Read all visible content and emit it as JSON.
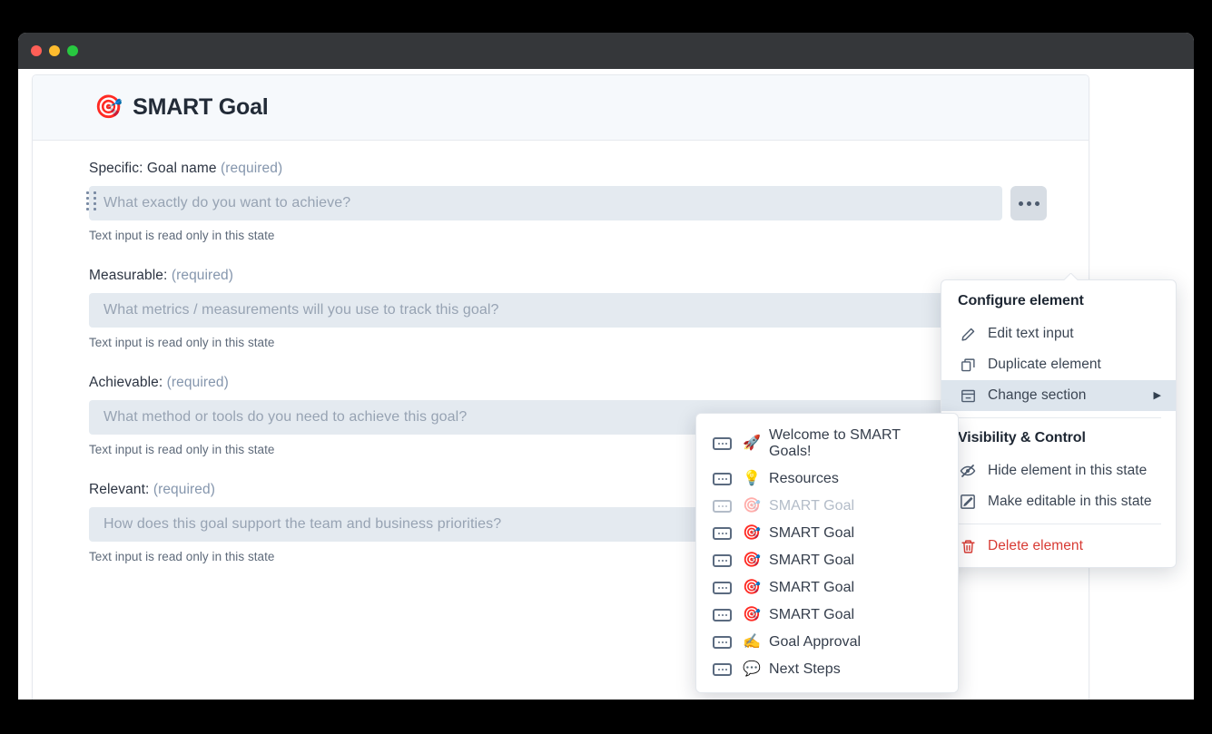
{
  "window": {
    "traffic_lights": [
      "close",
      "minimize",
      "maximize"
    ]
  },
  "card": {
    "emoji": "🎯",
    "title": "SMART Goal"
  },
  "fields": [
    {
      "label": "Specific: Goal name",
      "required": "(required)",
      "placeholder": "What exactly do you want to achieve?",
      "help": "Text input is read only in this state",
      "has_handle": true,
      "has_menu": true
    },
    {
      "label": "Measurable:",
      "required": "(required)",
      "placeholder": "What metrics / measurements will you use to track this goal?",
      "help": "Text input is read only in this state",
      "has_handle": false,
      "has_menu": false
    },
    {
      "label": "Achievable:",
      "required": "(required)",
      "placeholder": "What method or tools do you need to achieve this goal?",
      "help": "Text input is read only in this state",
      "has_handle": false,
      "has_menu": false
    },
    {
      "label": "Relevant:",
      "required": "(required)",
      "placeholder": "How does this goal support the team and business priorities?",
      "help": "Text input is read only in this state",
      "has_handle": false,
      "has_menu": false
    }
  ],
  "context_menu": {
    "group1_title": "Configure element",
    "items1": [
      {
        "label": "Edit text input",
        "icon": "pencil-icon"
      },
      {
        "label": "Duplicate element",
        "icon": "duplicate-icon"
      },
      {
        "label": "Change section",
        "icon": "section-icon",
        "active": true,
        "submenu_arrow": "▶"
      }
    ],
    "group2_title": "Visibility & Control",
    "items2": [
      {
        "label": "Hide element in this state",
        "icon": "eye-slash-icon"
      },
      {
        "label": "Make editable in this state",
        "icon": "edit-square-icon"
      }
    ],
    "delete_label": "Delete element",
    "delete_color": "#d83b34"
  },
  "submenu": {
    "items": [
      {
        "emoji": "🚀",
        "label": "Welcome to SMART Goals!",
        "dimmed": false
      },
      {
        "emoji": "💡",
        "label": "Resources",
        "dimmed": false
      },
      {
        "emoji": "🎯",
        "label": "SMART Goal",
        "dimmed": true
      },
      {
        "emoji": "🎯",
        "label": "SMART Goal",
        "dimmed": false
      },
      {
        "emoji": "🎯",
        "label": "SMART Goal",
        "dimmed": false
      },
      {
        "emoji": "🎯",
        "label": "SMART Goal",
        "dimmed": false
      },
      {
        "emoji": "🎯",
        "label": "SMART Goal",
        "dimmed": false
      },
      {
        "emoji": "✍️",
        "label": "Goal Approval",
        "dimmed": false
      },
      {
        "emoji": "💬",
        "label": "Next Steps",
        "dimmed": false
      }
    ]
  },
  "colors": {
    "accent": "#d83b34",
    "input_bg": "#e4eaf0",
    "header_bg": "#f6f9fc",
    "highlight": "#dde5ed"
  }
}
